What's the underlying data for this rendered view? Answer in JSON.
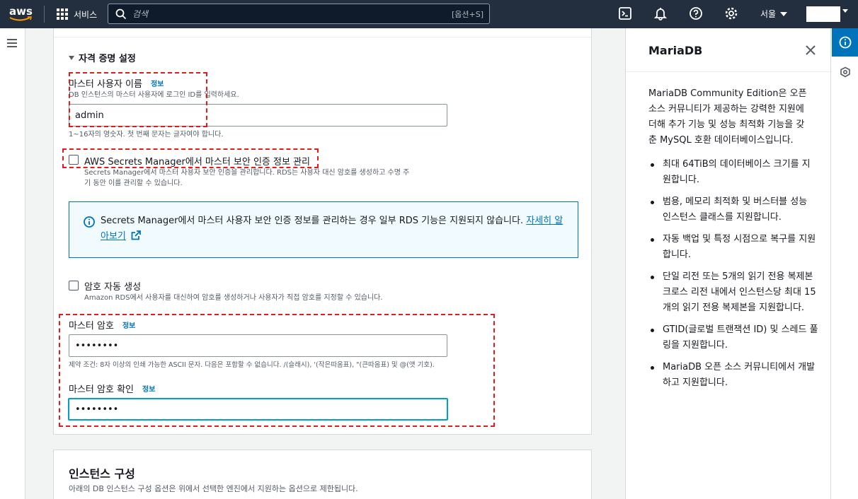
{
  "topbar": {
    "logo": "aws",
    "services_label": "서비스",
    "search_placeholder": "검색",
    "search_shortcut": "[옵션+S]",
    "region": "서울"
  },
  "form": {
    "section_title": "자격 증명 설정",
    "username_label": "마스터 사용자 이름",
    "username_info": "정보",
    "username_desc": "DB 인스턴스의 마스터 사용자에 로그인 ID를 입력하세요.",
    "username_value": "admin",
    "username_hint": "1~16자의 영숫자. 첫 번째 문자는 글자여야 합니다.",
    "secrets_checkbox_label": "AWS Secrets Manager에서 마스터 보안 인증 정보 관리",
    "secrets_desc_line1": "Secrets Manager에서 마스터 사용자 보안 인증을 관리합니다. RDS는 사용자 대신 암호를 생성하고 수명 주",
    "secrets_desc_line2": "기 동안 이를 관리할 수 있습니다.",
    "alert_text": "Secrets Manager에서 마스터 사용자 보안 인증 정보를 관리하는 경우 일부 RDS 기능은 지원되지 않습니다. ",
    "alert_link": "자세히 알아보기",
    "autogen_label": "암호 자동 생성",
    "autogen_desc": "Amazon RDS에서 사용자를 대신하여 암호를 생성하거나 사용자가 직접 암호를 지정할 수 있습니다.",
    "password_label": "마스터 암호",
    "password_info": "정보",
    "password_value": "••••••••",
    "password_constraint": "제약 조건: 8자 이상의 인쇄 가능한 ASCII 문자. 다음은 포함할 수 없습니다. /(슬래시), '(작은따옴표), \"(큰따옴표) 및 @(앳 기호).",
    "confirm_label": "마스터 암호 확인",
    "confirm_info": "정보",
    "confirm_value": "••••••••"
  },
  "instance_section": {
    "title": "인스턴스 구성",
    "desc": "아래의 DB 인스턴스 구성 옵션은 위에서 선택한 엔진에서 지원하는 옵션으로 제한됩니다."
  },
  "help": {
    "title": "MariaDB",
    "intro": "MariaDB Community Edition은 오픈 소스 커뮤니티가 제공하는 강력한 지원에 더해 추가 기능 및 성능 최적화 기능을 갖춘 MySQL 호환 데이터베이스입니다.",
    "bullets": [
      "최대 64TiB의 데이터베이스 크기를 지원합니다.",
      "범용, 메모리 최적화 및 버스터블 성능 인스턴스 클래스를 지원합니다.",
      "자동 백업 및 특정 시점으로 복구를 지원합니다.",
      "단일 리전 또는 5개의 읽기 전용 복제본 크로스 리전 내에서 인스턴스당 최대 15개의 읽기 전용 복제본을 지원합니다.",
      "GTID(글로벌 트랜잭션 ID) 및 스레드 풀링을 지원합니다.",
      "MariaDB 오픈 소스 커뮤니티에서 개발하고 지원합니다."
    ]
  },
  "colors": {
    "topbar": "#232f3e",
    "link": "#0073bb",
    "annotation": "#e31b1b",
    "focus": "#00a1c9"
  }
}
